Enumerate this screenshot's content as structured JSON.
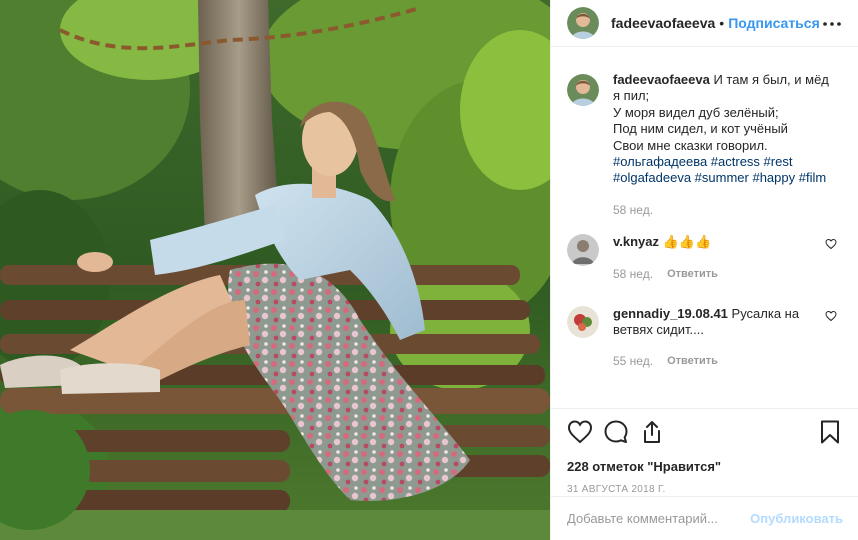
{
  "post": {
    "image_alt": "Photo of a woman sitting on a wooden bench under a tree"
  },
  "header": {
    "username": "fadeevaofaeeva",
    "separator": "•",
    "follow_label": "Подписаться",
    "more_icon": "more-horizontal-icon"
  },
  "caption": {
    "author": "fadeevaofaeeva",
    "lines": [
      "И там я был, и мёд",
      "я пил;",
      "У моря видел дуб зелёный;",
      "Под ним сидел, и кот учёный",
      "Свои мне сказки говорил."
    ],
    "hashtags_line1": "#ольгафадеева #actress #rest",
    "hashtags_line2": "#olgafadeeva #summer #happy #film",
    "time": "58 нед."
  },
  "comments": [
    {
      "author": "v.knyaz",
      "text": "👍👍👍",
      "time": "58 нед.",
      "reply_label": "Ответить"
    },
    {
      "author": "gennadiy_19.08.41",
      "text_line1": "Русалка на",
      "text_line2": "ветвях сидит....",
      "time": "55 нед.",
      "reply_label": "Ответить"
    }
  ],
  "actions": {
    "like_icon": "heart-icon",
    "comment_icon": "comment-icon",
    "share_icon": "share-icon",
    "save_icon": "bookmark-icon",
    "likes_text": "228 отметок \"Нравится\"",
    "date_text": "31 АВГУСТА 2018 Г."
  },
  "add_comment": {
    "placeholder": "Добавьте комментарий...",
    "publish_label": "Опубликовать"
  },
  "colors": {
    "link_blue": "#3897f0",
    "hashtag": "#003569",
    "muted": "#999999",
    "publish_disabled": "#b3dbff"
  }
}
